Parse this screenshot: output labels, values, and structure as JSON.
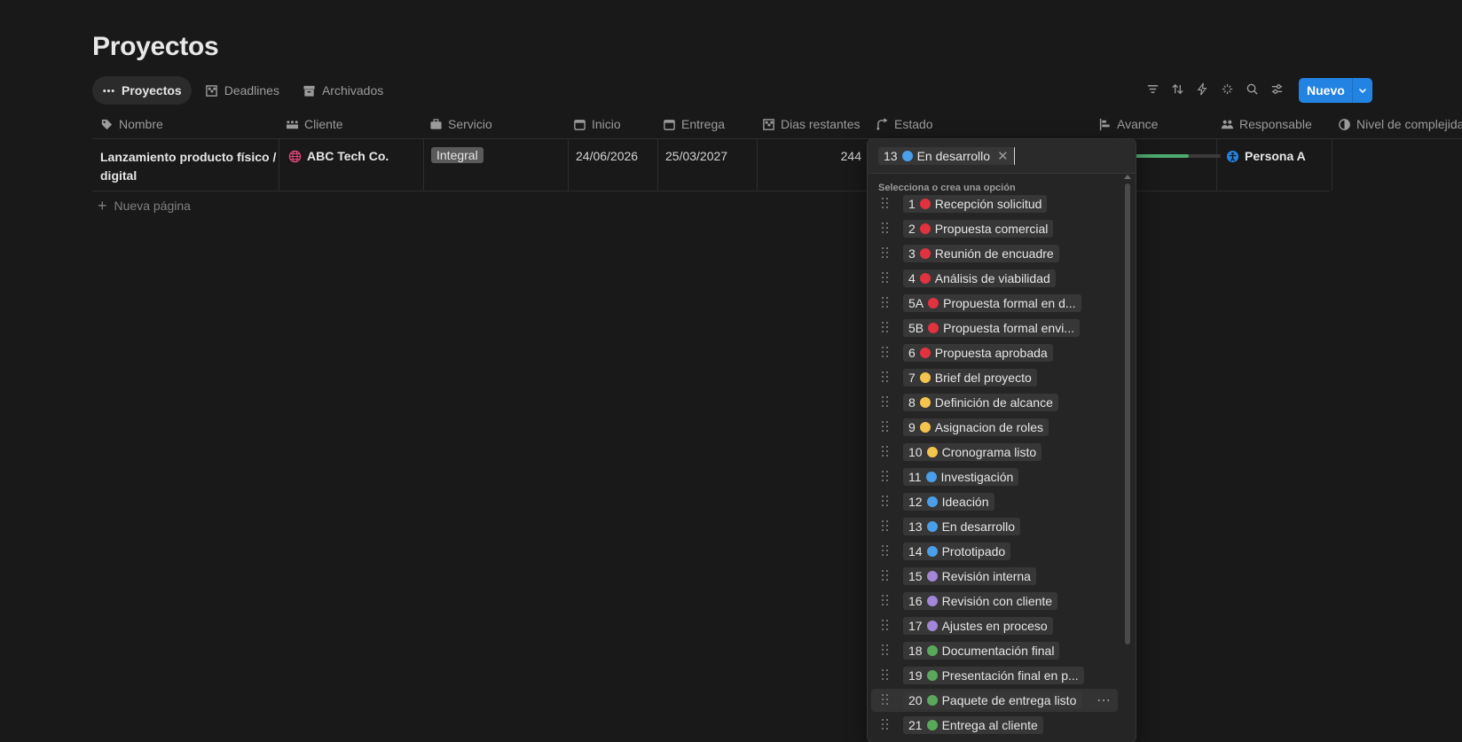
{
  "page": {
    "title": "Proyectos"
  },
  "views": [
    {
      "label": "Proyectos",
      "icon": "more-dots-icon",
      "active": true
    },
    {
      "label": "Deadlines",
      "icon": "checkered-flag-icon",
      "active": false
    },
    {
      "label": "Archivados",
      "icon": "archive-box-icon",
      "active": false
    }
  ],
  "toolbar": {
    "icons": [
      "filter-icon",
      "sort-icon",
      "lightning-icon",
      "sparkle-icon",
      "search-icon",
      "settings-sliders-icon"
    ],
    "new_label": "Nuevo",
    "accent": "#2383e2"
  },
  "columns": [
    {
      "label": "Nombre",
      "icon": "tag-icon"
    },
    {
      "label": "Cliente",
      "icon": "people-group-icon"
    },
    {
      "label": "Servicio",
      "icon": "briefcase-icon"
    },
    {
      "label": "Inicio",
      "icon": "calendar-icon"
    },
    {
      "label": "Entrega",
      "icon": "calendar-icon"
    },
    {
      "label": "Dias restantes",
      "icon": "checkered-flag-icon"
    },
    {
      "label": "Estado",
      "icon": "status-arrows-icon"
    },
    {
      "label": "Avance",
      "icon": "bar-chart-icon"
    },
    {
      "label": "Responsable",
      "icon": "people-icon"
    },
    {
      "label": "Nivel de complejidad",
      "icon": "half-circle-icon"
    }
  ],
  "rows": [
    {
      "nombre": "Lanzamiento producto físico / digital",
      "cliente": "ABC Tech Co.",
      "servicio": "Integral",
      "inicio": "24/06/2026",
      "entrega": "25/03/2027",
      "dias_restantes": "244",
      "avance_fraction": 0.62,
      "responsable": "Persona A"
    }
  ],
  "new_page_label": "Nueva página",
  "status_dropdown": {
    "selected": {
      "num": "13",
      "label": "En desarrollo",
      "color": "#4a9fe8"
    },
    "hint": "Selecciona o crea una opción",
    "options": [
      {
        "num": "1",
        "label": "Recepción solicitud",
        "color": "#e0323f"
      },
      {
        "num": "2",
        "label": "Propuesta comercial",
        "color": "#e0323f"
      },
      {
        "num": "3",
        "label": "Reunión de encuadre",
        "color": "#e0323f"
      },
      {
        "num": "4",
        "label": "Análisis de viabilidad",
        "color": "#e0323f"
      },
      {
        "num": "5A",
        "label": "Propuesta formal en d...",
        "color": "#e0323f"
      },
      {
        "num": "5B",
        "label": "Propuesta formal envi...",
        "color": "#e0323f"
      },
      {
        "num": "6",
        "label": "Propuesta aprobada",
        "color": "#e0323f"
      },
      {
        "num": "7",
        "label": "Brief del proyecto",
        "color": "#f3c44e"
      },
      {
        "num": "8",
        "label": "Definición de alcance",
        "color": "#f3c44e"
      },
      {
        "num": "9",
        "label": "Asignacion de roles",
        "color": "#f3c44e"
      },
      {
        "num": "10",
        "label": "Cronograma listo",
        "color": "#f3c44e"
      },
      {
        "num": "11",
        "label": "Investigación",
        "color": "#4a9fe8"
      },
      {
        "num": "12",
        "label": "Ideación",
        "color": "#4a9fe8"
      },
      {
        "num": "13",
        "label": "En desarrollo",
        "color": "#4a9fe8"
      },
      {
        "num": "14",
        "label": "Prototipado",
        "color": "#4a9fe8"
      },
      {
        "num": "15",
        "label": "Revisión interna",
        "color": "#a286d8"
      },
      {
        "num": "16",
        "label": "Revisión con cliente",
        "color": "#a286d8"
      },
      {
        "num": "17",
        "label": "Ajustes en proceso",
        "color": "#a286d8"
      },
      {
        "num": "18",
        "label": "Documentación final",
        "color": "#5aa85c"
      },
      {
        "num": "19",
        "label": "Presentación final en p...",
        "color": "#5aa85c"
      },
      {
        "num": "20",
        "label": "Paquete de entrega listo",
        "color": "#5aa85c",
        "highlighted": true
      },
      {
        "num": "21",
        "label": "Entrega al cliente",
        "color": "#5aa85c"
      }
    ]
  }
}
